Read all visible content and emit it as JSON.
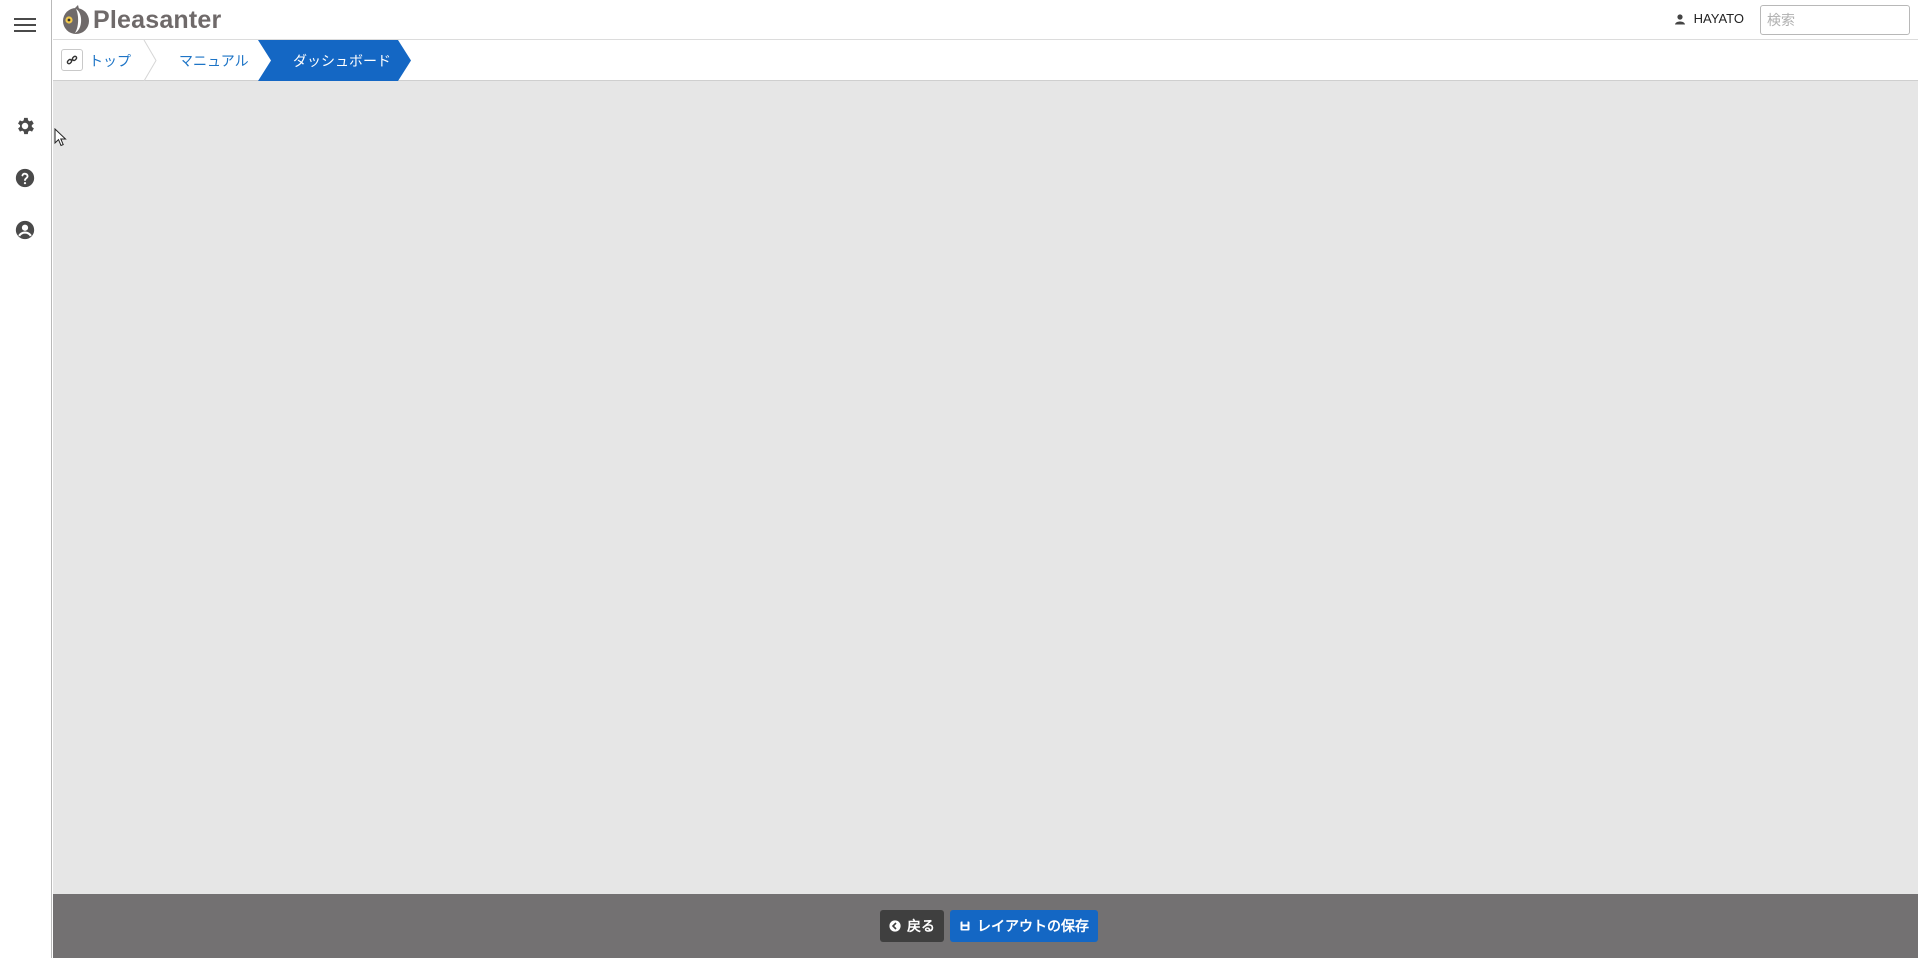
{
  "app": {
    "name": "Pleasanter"
  },
  "header": {
    "user_name": "HAYATO",
    "search_placeholder": "検索"
  },
  "breadcrumb": {
    "items": [
      {
        "label": "トップ",
        "active": false
      },
      {
        "label": "マニュアル",
        "active": false
      },
      {
        "label": "ダッシュボード",
        "active": true
      }
    ]
  },
  "sidebar": {
    "icons": [
      "menu-icon",
      "gear-icon",
      "help-icon",
      "user-circle-icon"
    ]
  },
  "footer": {
    "back_label": "戻る",
    "save_label": "レイアウトの保存"
  },
  "colors": {
    "accent": "#1467c4",
    "footer_bg": "#737172",
    "main_bg": "#e6e6e6",
    "back_button": "#3f3f3f"
  }
}
